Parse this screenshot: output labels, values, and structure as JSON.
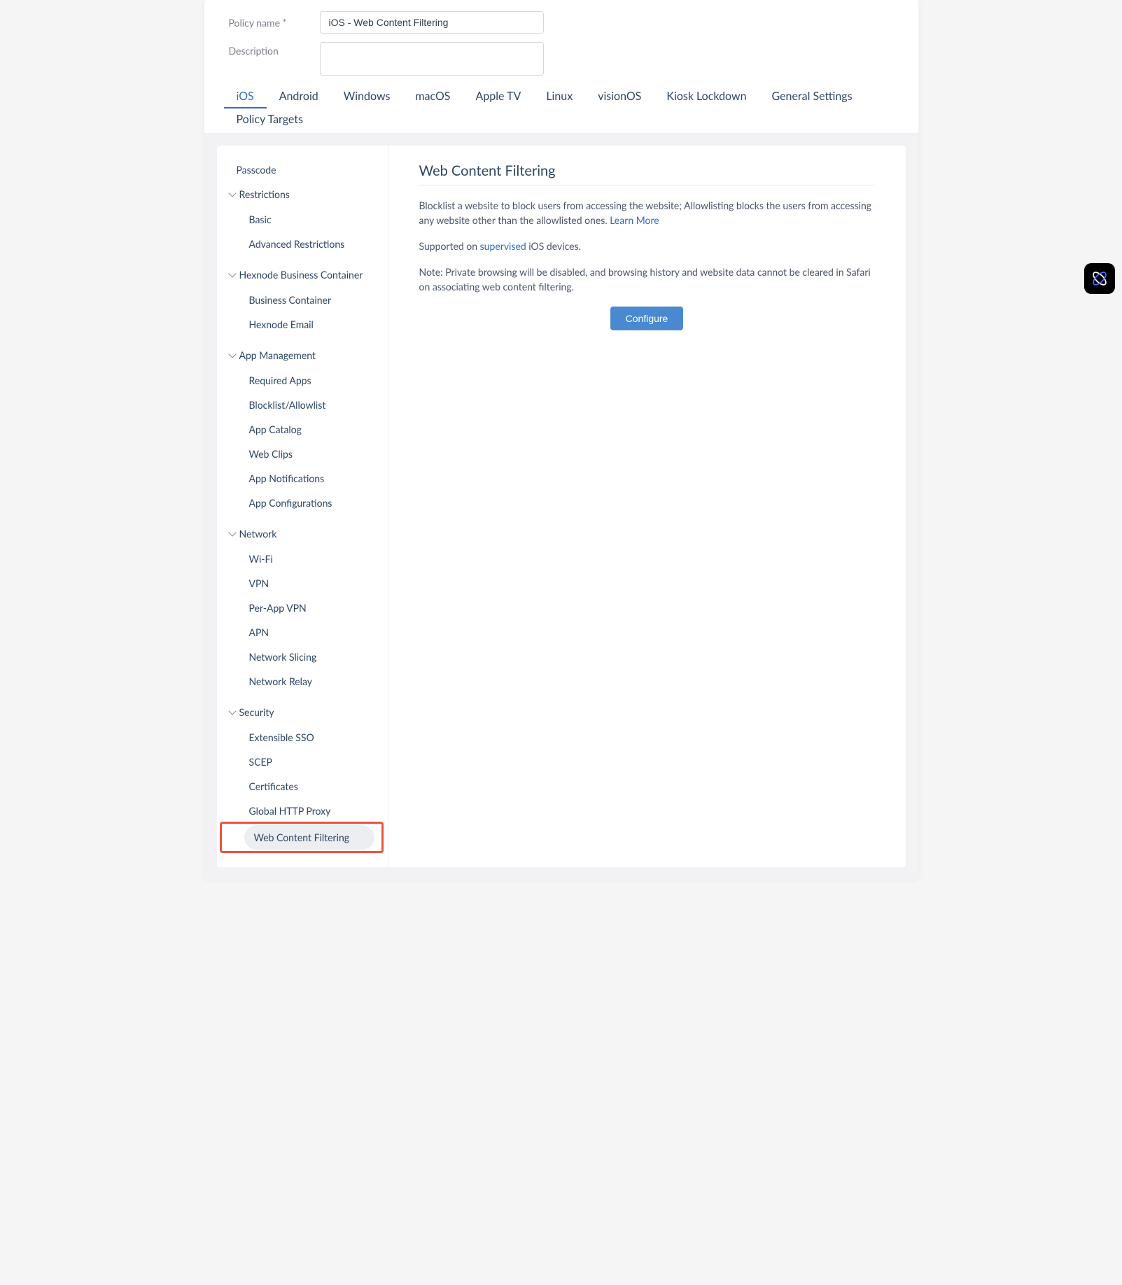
{
  "form": {
    "policy_name_label": "Policy name *",
    "policy_name_value": "iOS - Web Content Filtering",
    "description_label": "Description",
    "description_value": ""
  },
  "tabs": {
    "ios": "iOS",
    "android": "Android",
    "windows": "Windows",
    "macos": "macOS",
    "appletv": "Apple TV",
    "linux": "Linux",
    "visionos": "visionOS",
    "kiosk": "Kiosk Lockdown",
    "general": "General Settings",
    "targets": "Policy Targets"
  },
  "sidebar": {
    "passcode": "Passcode",
    "restrictions": "Restrictions",
    "basic": "Basic",
    "advanced_restrictions": "Advanced Restrictions",
    "hexnode_container": "Hexnode Business Container",
    "business_container": "Business Container",
    "hexnode_email": "Hexnode Email",
    "app_management": "App Management",
    "required_apps": "Required Apps",
    "blocklist_allowlist": "Blocklist/Allowlist",
    "app_catalog": "App Catalog",
    "web_clips": "Web Clips",
    "app_notifications": "App Notifications",
    "app_configurations": "App Configurations",
    "network": "Network",
    "wifi": "Wi-Fi",
    "vpn": "VPN",
    "per_app_vpn": "Per-App VPN",
    "apn": "APN",
    "network_slicing": "Network Slicing",
    "network_relay": "Network Relay",
    "security": "Security",
    "extensible_sso": "Extensible SSO",
    "scep": "SCEP",
    "certificates": "Certificates",
    "global_http_proxy": "Global HTTP Proxy",
    "web_content_filtering": "Web Content Filtering"
  },
  "main": {
    "title": "Web Content Filtering",
    "p1a": "Blocklist a website to block users from accessing the website; Allowlisting blocks the users from accessing any website other than the allowlisted ones. ",
    "learn_more": "Learn More",
    "p2a": "Supported on ",
    "supervised": "supervised",
    "p2b": " iOS devices.",
    "p3": "Note: Private browsing will be disabled, and browsing history and website data cannot be cleared in Safari on associating web content filtering.",
    "configure": "Configure"
  }
}
